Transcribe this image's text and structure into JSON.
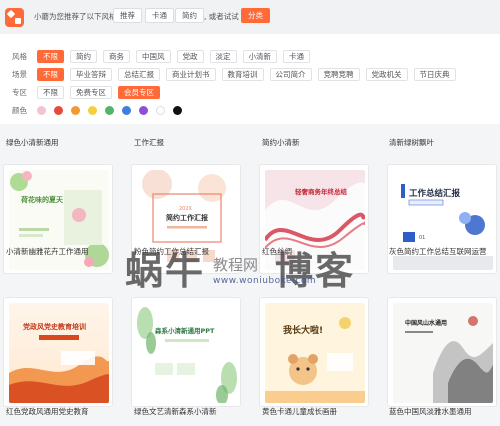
{
  "topbar": {
    "suggest_text": "小蘑为您推荐了以下风格",
    "chips": [
      "推荐",
      "卡通",
      "简约"
    ],
    "tail_text": ", 或者试试",
    "category_label": "分类"
  },
  "filters": {
    "style": {
      "label": "风格",
      "options": [
        "不限",
        "简约",
        "商务",
        "中国风",
        "党政",
        "淡定",
        "小清新",
        "卡通"
      ]
    },
    "scene": {
      "label": "场景",
      "options": [
        "不限",
        "毕业答辩",
        "总结汇报",
        "商业计划书",
        "教育培训",
        "公司简介",
        "竞聘竞聘",
        "党政机关",
        "节日庆典"
      ]
    },
    "zone": {
      "label": "专区",
      "options": [
        "不限",
        "免费专区",
        "会员专区"
      ]
    },
    "color": {
      "label": "颜色",
      "swatches": [
        "#f2c4cf",
        "#e34b3f",
        "#f39a2c",
        "#f5cf3c",
        "#52b36a",
        "#3f7fe0",
        "#8c4fd6",
        "#ffffff",
        "#111111"
      ]
    }
  },
  "top_captions": [
    "绿色小清新通用",
    "工作汇报",
    "简约小清新",
    "清新绿树飘叶"
  ],
  "cards": [
    {
      "caption": "小清新幽雅花卉工作通用",
      "slide_title": "荷花味的夏天",
      "accent": "#4e8f3a"
    },
    {
      "caption": "粉色简约工作总结汇报",
      "slide_title": "简约工作汇报",
      "accent": "#e8866a"
    },
    {
      "caption": "红色丝绸",
      "slide_title": "轻奢商务年终总结",
      "accent": "#d23040"
    },
    {
      "caption": "灰色简约工作总结互联网运营",
      "slide_title": "工作总结汇报",
      "accent": "#2e5fc9"
    },
    {
      "caption": "红色党政风通用党史教育",
      "slide_title": "党政风党史教育培训",
      "accent": "#d74a1f"
    },
    {
      "caption": "绿色文艺清新森系小清新",
      "slide_title": "森系小清新通用PPT",
      "accent": "#3f9a54"
    },
    {
      "caption": "黄色卡通儿童成长画册",
      "slide_title": "我长大啦!",
      "accent": "#e3893a"
    },
    {
      "caption": "蓝色中国风淡雅水墨通用",
      "slide_title": "中国风山水通用",
      "accent": "#444444"
    }
  ],
  "watermark": {
    "big": "蜗牛",
    "big2": "博客",
    "mid": "教程网",
    "url": "www.woniuboke.com"
  }
}
